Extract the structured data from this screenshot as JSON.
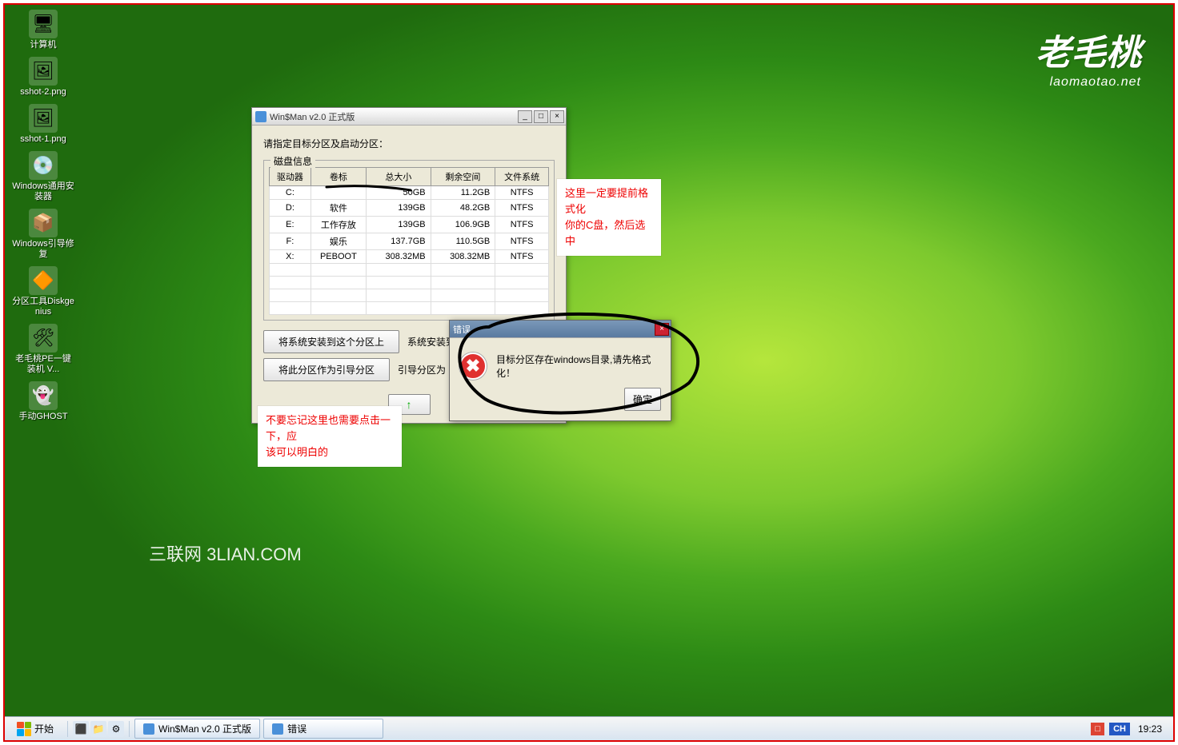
{
  "brand": {
    "title": "老毛桃",
    "subtitle": "laomaotao.net"
  },
  "desktop_icons": [
    {
      "label": "计算机",
      "glyph": "🖥"
    },
    {
      "label": "sshot-2.png",
      "glyph": "🖼"
    },
    {
      "label": "sshot-1.png",
      "glyph": "🖼"
    },
    {
      "label": "Windows通用安装器",
      "glyph": "💿"
    },
    {
      "label": "Windows引导修复",
      "glyph": "📦"
    },
    {
      "label": "分区工具Diskgenius",
      "glyph": "🔶"
    },
    {
      "label": "老毛桃PE一键装机 V...",
      "glyph": "🛠"
    },
    {
      "label": "手动GHOST",
      "glyph": "👻"
    }
  ],
  "watermark": "三联网 3LIAN.COM",
  "main_window": {
    "title": "Win$Man v2.0 正式版",
    "instruction": "请指定目标分区及启动分区：",
    "group_title": "磁盘信息",
    "columns": [
      "驱动器",
      "卷标",
      "总大小",
      "剩余空间",
      "文件系统"
    ],
    "rows": [
      {
        "drive": "C:",
        "label": "",
        "total": "50GB",
        "free": "11.2GB",
        "fs": "NTFS"
      },
      {
        "drive": "D:",
        "label": "软件",
        "total": "139GB",
        "free": "48.2GB",
        "fs": "NTFS"
      },
      {
        "drive": "E:",
        "label": "工作存放",
        "total": "139GB",
        "free": "106.9GB",
        "fs": "NTFS"
      },
      {
        "drive": "F:",
        "label": "娱乐",
        "total": "137.7GB",
        "free": "110.5GB",
        "fs": "NTFS"
      },
      {
        "drive": "X:",
        "label": "PEBOOT",
        "total": "308.32MB",
        "free": "308.32MB",
        "fs": "NTFS"
      }
    ],
    "btn_install": "将系统安装到这个分区上",
    "btn_install_status": "系统安装到",
    "btn_boot": "将此分区作为引导分区",
    "btn_boot_status": "引导分区为",
    "btn_confirm_prefix": "↑"
  },
  "error_dialog": {
    "title": "错误",
    "message": "目标分区存在windows目录,请先格式化！",
    "ok": "确定"
  },
  "annotations": {
    "note1_line1": "这里一定要提前格式化",
    "note1_line2": "你的C盘，然后选中",
    "note2_line1": "不要忘记这里也需要点击一下，应",
    "note2_line2": "该可以明白的"
  },
  "taskbar": {
    "start": "开始",
    "tasks": [
      {
        "label": "Win$Man v2.0 正式版"
      },
      {
        "label": "错误"
      }
    ],
    "ime1": "□",
    "ime2": "CH",
    "time": "19:23"
  }
}
